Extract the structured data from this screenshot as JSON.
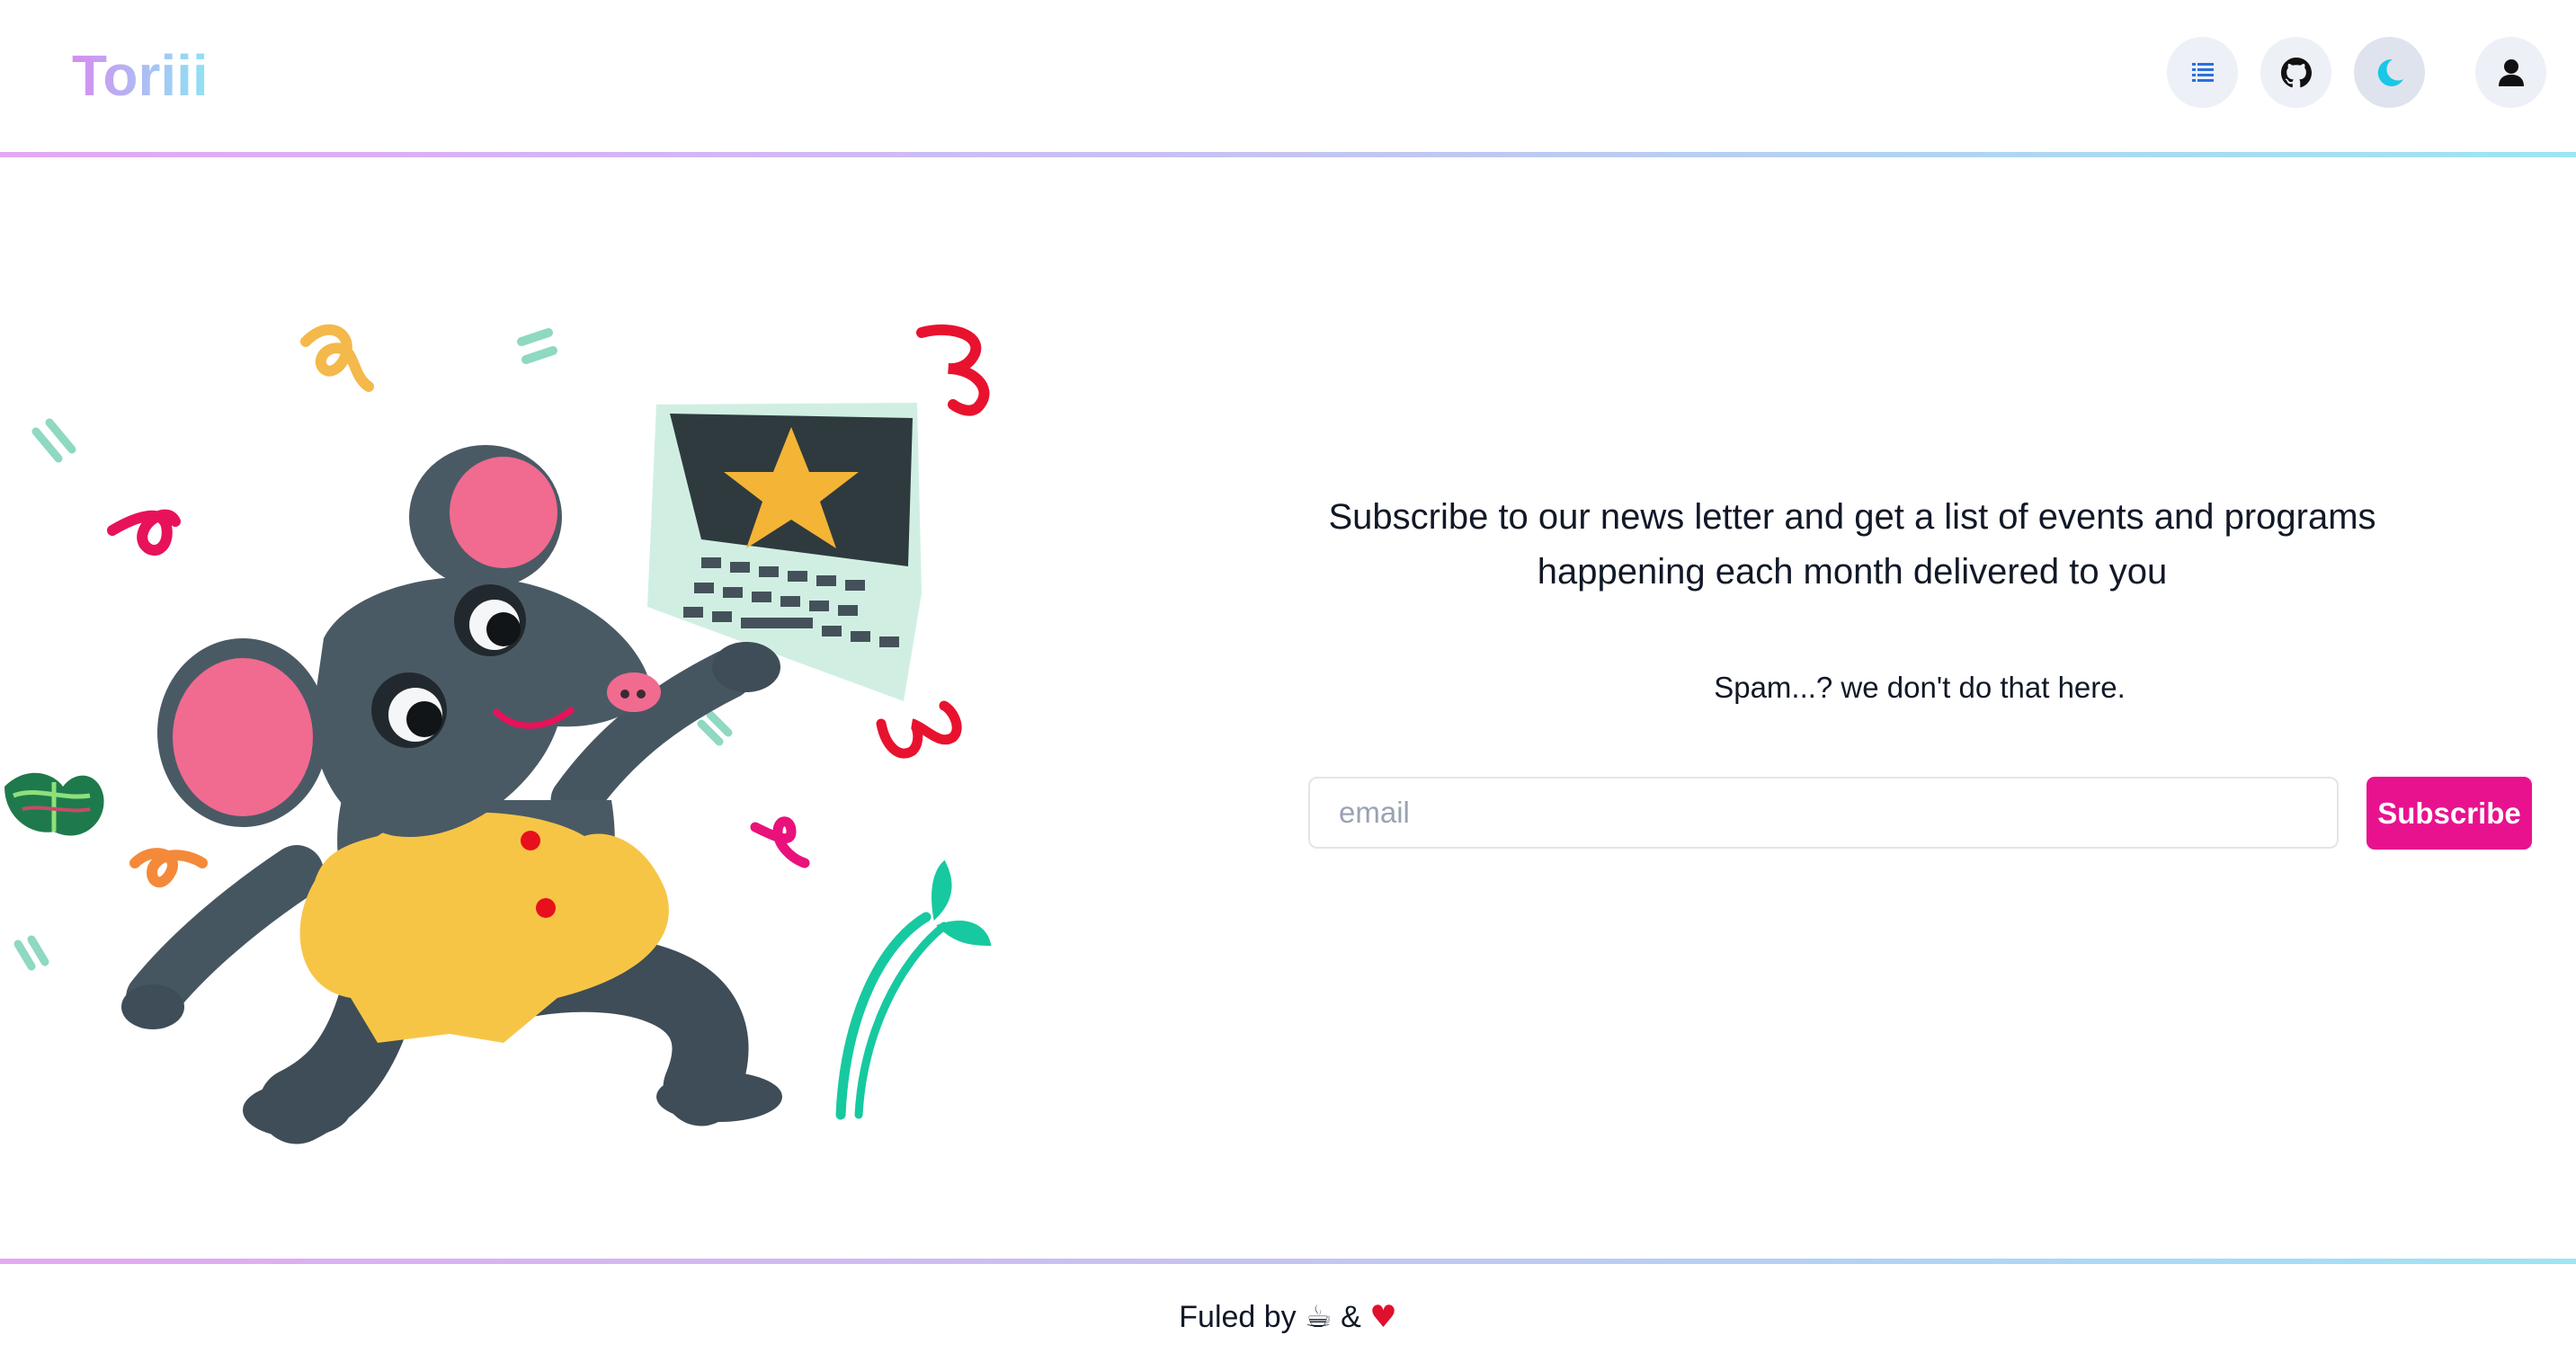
{
  "header": {
    "brand": "Toriii",
    "nav_icons": [
      {
        "name": "list-icon",
        "color": "#2d6fdc"
      },
      {
        "name": "github-icon",
        "color": "#111111"
      },
      {
        "name": "moon-icon",
        "color": "#18c8e6"
      },
      {
        "name": "user-icon",
        "color": "#111111"
      }
    ]
  },
  "main": {
    "illustration": "mouse-with-laptop",
    "headline": "Subscribe to our news letter and get a list of events and programs happening each month delivered to you",
    "subline": "Spam...? we don't do that here.",
    "email_placeholder": "email",
    "email_value": "",
    "subscribe_label": "Subscribe"
  },
  "footer": {
    "prefix": "Fuled by",
    "coffee_glyph": "☕",
    "amp": "&",
    "heart_glyph": "♥"
  },
  "colors": {
    "accent": "#e8128f",
    "rule_gradient_start": "#e4a8f2",
    "rule_gradient_end": "#9ee4f4"
  }
}
